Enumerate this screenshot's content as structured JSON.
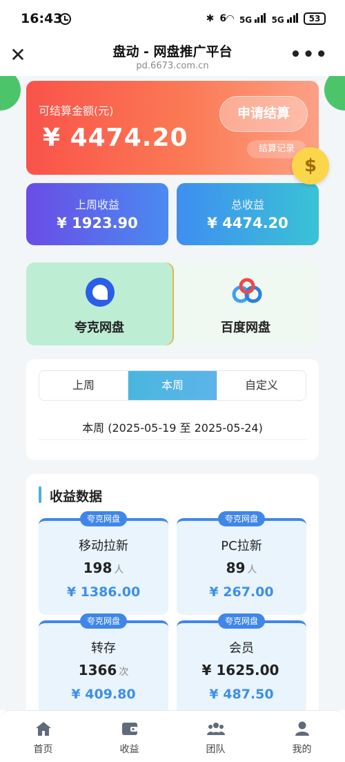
{
  "status_bar": {
    "time": "16:43",
    "network_1": "6",
    "network_2": "5G",
    "network_3": "5G",
    "battery": "53"
  },
  "header": {
    "title": "盘动 - 网盘推广平台",
    "url": "pd.6673.com.cn"
  },
  "balance": {
    "label": "可结算金额(元)",
    "amount": "¥ 4474.20",
    "apply_button": "申请结算",
    "record_button": "结算记录",
    "coin_icon": "$"
  },
  "stats": {
    "last_week_label": "上周收益",
    "last_week_value": "¥ 1923.90",
    "total_label": "总收益",
    "total_value": "¥ 4474.20"
  },
  "disks": [
    {
      "label": "夸克网盘",
      "icon": "quark-icon",
      "active": true
    },
    {
      "label": "百度网盘",
      "icon": "baidu-icon",
      "active": false
    }
  ],
  "period": {
    "tabs": [
      "上周",
      "本周",
      "自定义"
    ],
    "active_index": 1,
    "range_text": "本周 (2025-05-19 至 2025-05-24)"
  },
  "earnings": {
    "title": "收益数据",
    "tiles": [
      {
        "badge": "夸克网盘",
        "name": "移动拉新",
        "count": "198",
        "unit": "人",
        "amount": "¥ 1386.00"
      },
      {
        "badge": "夸克网盘",
        "name": "PC拉新",
        "count": "89",
        "unit": "人",
        "amount": "¥ 267.00"
      },
      {
        "badge": "夸克网盘",
        "name": "转存",
        "count": "1366",
        "unit": "次",
        "amount": "¥ 409.80"
      },
      {
        "badge": "夸克网盘",
        "name": "会员",
        "count": "¥ 1625.00",
        "unit": "",
        "amount": "¥ 487.50"
      }
    ]
  },
  "tabbar": [
    {
      "label": "首页",
      "icon": "home-icon"
    },
    {
      "label": "收益",
      "icon": "wallet-icon"
    },
    {
      "label": "团队",
      "icon": "team-icon"
    },
    {
      "label": "我的",
      "icon": "user-icon"
    }
  ],
  "colors": {
    "accent_blue": "#3f86e8",
    "balance_gradient_start": "#f9534a",
    "balance_gradient_end": "#fca085"
  }
}
